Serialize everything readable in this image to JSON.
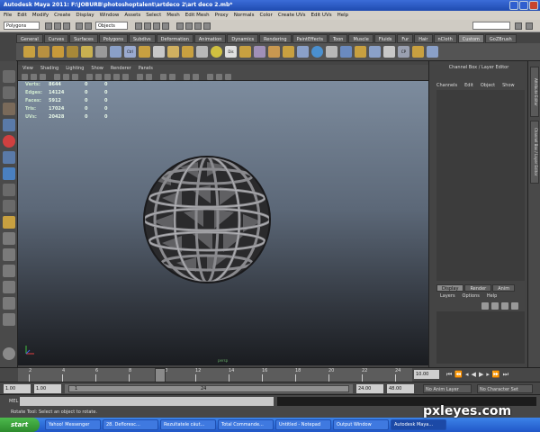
{
  "window": {
    "title": "Autodesk Maya 2011: F:\\JOBURB\\photoshoptalent\\artdeco 2\\art deco 2.mb*"
  },
  "menubar": [
    "File",
    "Edit",
    "Modify",
    "Create",
    "Display",
    "Window",
    "Assets",
    "Select",
    "Mesh",
    "Edit Mesh",
    "Proxy",
    "Normals",
    "Color",
    "Create UVs",
    "Edit UVs",
    "Help"
  ],
  "statusline": {
    "mode": "Polygons",
    "objects_field": "Objects"
  },
  "shelf_tabs": [
    "General",
    "Curves",
    "Surfaces",
    "Polygons",
    "Subdivs",
    "Deformation",
    "Animation",
    "Dynamics",
    "Rendering",
    "PaintEffects",
    "Toon",
    "Muscle",
    "Fluids",
    "Fur",
    "Hair",
    "nCloth",
    "Custom",
    "GoZBrush"
  ],
  "shelf_active_tab": "Custom",
  "shelf_icon_labels": [
    "Ctrl",
    "Dis",
    "CP"
  ],
  "panel_menu": [
    "View",
    "Shading",
    "Lighting",
    "Show",
    "Renderer",
    "Panels"
  ],
  "hud": [
    {
      "label": "Verts:",
      "value": "8644",
      "sel": "0",
      "comp": "0"
    },
    {
      "label": "Edges:",
      "value": "14124",
      "sel": "0",
      "comp": "0"
    },
    {
      "label": "Faces:",
      "value": "5912",
      "sel": "0",
      "comp": "0"
    },
    {
      "label": "Tris:",
      "value": "17024",
      "sel": "0",
      "comp": "0"
    },
    {
      "label": "UVs:",
      "value": "20428",
      "sel": "0",
      "comp": "0"
    }
  ],
  "camera_label": "persp",
  "channel_box": {
    "title": "Channel Box / Layer Editor",
    "menu": [
      "Channels",
      "Edit",
      "Object",
      "Show"
    ],
    "layer_tabs": [
      "Display",
      "Render",
      "Anim"
    ],
    "layer_menu": [
      "Layers",
      "Options",
      "Help"
    ]
  },
  "side_tabs": [
    "Attribute Editor",
    "Channel Box / Layer Editor"
  ],
  "time_slider": {
    "ticks": [
      "2",
      "4",
      "6",
      "8",
      "10",
      "12",
      "14",
      "16",
      "18",
      "20",
      "22",
      "24"
    ],
    "current_frame": "10.00"
  },
  "range_slider": {
    "start": "1.00",
    "start2": "1.00",
    "handle_start": "1",
    "handle_end": "24",
    "end": "24.00",
    "end2": "48.00",
    "anim_layer": "No Anim Layer",
    "character_set": "No Character Set"
  },
  "command_line": {
    "label": "MEL"
  },
  "help_line": "Rotate Tool: Select an object to rotate.",
  "taskbar": {
    "start": "start",
    "items": [
      "Yahoo! Messenger",
      "28. Defloresc...",
      "Rezultatele căut...",
      "Total Commande...",
      "Untitled - Notepad",
      "Output Window",
      "Autodesk Maya..."
    ]
  },
  "watermark": "pxleyes.com"
}
